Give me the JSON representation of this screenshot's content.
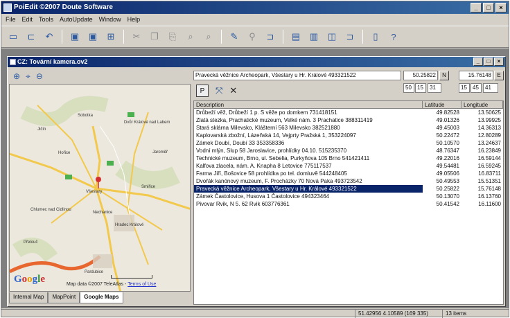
{
  "app": {
    "title": "PoiEdit ©2007 Doute Software"
  },
  "menu": [
    "File",
    "Edit",
    "Tools",
    "AutoUpdate",
    "Window",
    "Help"
  ],
  "document": {
    "title": "CZ: Tovární kamera.ov2"
  },
  "selection": {
    "text": "Pravecká věžnice Archeopark, Všestary u Hr. Králové 493321522",
    "lat": "50.25822",
    "lat_dir": "N",
    "lon": "15.76148",
    "lon_dir": "E",
    "lat_dms": [
      "50",
      "15",
      "31"
    ],
    "lon_dms": [
      "15",
      "45",
      "41"
    ]
  },
  "list": {
    "headers": [
      "Description",
      "Latitude",
      "Longitude"
    ],
    "rows": [
      {
        "desc": "Drůbeží věž, Drůbeží 1 p. S věže po domkem 731418151",
        "lat": "49.82528",
        "lon": "13.50625"
      },
      {
        "desc": "Zlatá stezka, Prachatické muzeum, Velké nám. 3 Prachatice 388311419",
        "lat": "49.01326",
        "lon": "13.99925"
      },
      {
        "desc": "Stará sklárna Milevsko, Klášterní 563 Milevsko 382521880",
        "lat": "49.45003",
        "lon": "14.36313"
      },
      {
        "desc": "Kaplovarská zbožní, Lázeňská 14, Vejprty Pražská 1, 353224097",
        "lat": "50.22472",
        "lon": "12.80289"
      },
      {
        "desc": "Zámek Doubí, Doubí 33 353358336",
        "lat": "50.10570",
        "lon": "13.24637"
      },
      {
        "desc": "Vodní mlýn, Slup 58 Jaroslavice, prohlídky 04.10. 515235370",
        "lat": "48.76347",
        "lon": "16.23849"
      },
      {
        "desc": "Technické muzeum, Brno, ul. Sebelia, Purkyňova 105 Brno 541421411",
        "lat": "49.22016",
        "lon": "16.59144"
      },
      {
        "desc": "Kalfova zlacela, nám. A. Knapha 8 Letovice 775117537",
        "lat": "49.54481",
        "lon": "16.59245"
      },
      {
        "desc": "Farma Jiří, Bošovice 58 prohlídka po tel. domluvě 544248405",
        "lat": "49.05506",
        "lon": "16.83711"
      },
      {
        "desc": "Dvořák kanónový muzeum, F. Procházky 70 Nová Paka 493723542",
        "lat": "50.49553",
        "lon": "15.51351"
      },
      {
        "desc": "Pravecká věžnice Archeopark, Všestary u Hr. Králové 493321522",
        "lat": "50.25822",
        "lon": "15.76148"
      },
      {
        "desc": "Zámek Častolovice, Husova 1 Častolovice 494323464",
        "lat": "50.13070",
        "lon": "16.13760"
      },
      {
        "desc": "Pivovar Rvik, N 5. 62 Rvik 603776361",
        "lat": "50.41542",
        "lon": "16.11600"
      }
    ],
    "selected_index": 10
  },
  "map": {
    "tabs": [
      "Internal Map",
      "MapPoint",
      "Google Maps"
    ],
    "active_tab": 2,
    "copyright": "Map data ©2007 TeleAtlas -",
    "copyright_link": "Terms of Use",
    "logo": "Google",
    "labels": [
      {
        "text": "Jičín"
      },
      {
        "text": "Dvůr Králové nad Labem"
      },
      {
        "text": "Sobotka"
      },
      {
        "text": "Jaroměř"
      },
      {
        "text": "Hořice"
      },
      {
        "text": "Všestary"
      },
      {
        "text": "Hradec Králové"
      },
      {
        "text": "Pardubice"
      },
      {
        "text": "Chlumec nad Cidlinou"
      },
      {
        "text": "Nechanice"
      },
      {
        "text": "Smiřice"
      },
      {
        "text": "Přelouč"
      }
    ]
  },
  "status": {
    "coords": "51.42956 4.10589 (169 335)",
    "count": "13 items"
  }
}
